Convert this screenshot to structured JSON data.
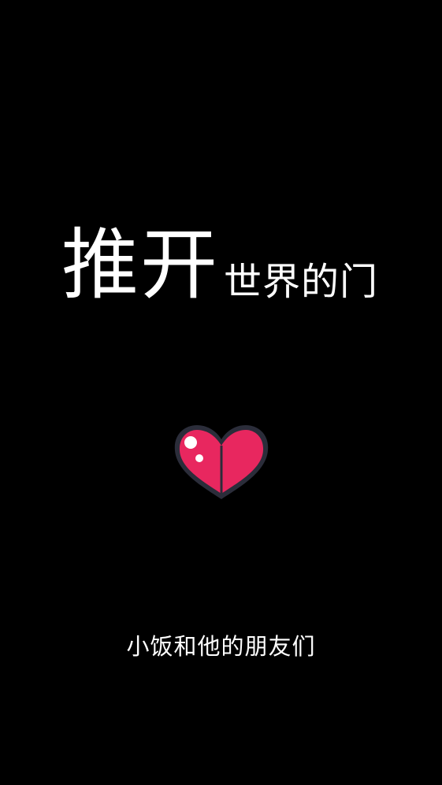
{
  "headline": {
    "big_text": "推开",
    "small_text": "世界的门"
  },
  "icon": {
    "name": "heart-icon",
    "fill_color": "#e8275f",
    "outline_color": "#2b2d3a",
    "highlight_color": "#ffffff"
  },
  "footer": {
    "text": "小饭和他的朋友们"
  },
  "colors": {
    "background": "#000000",
    "text": "#ffffff"
  }
}
